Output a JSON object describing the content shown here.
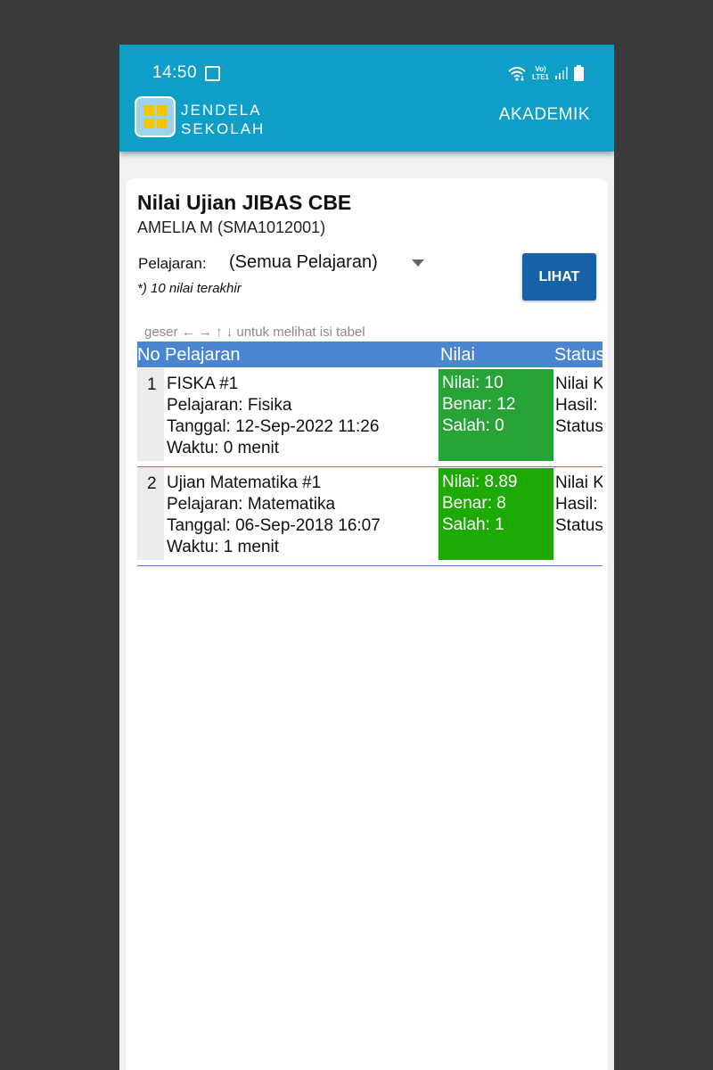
{
  "colors": {
    "appbar": "#0e9ec6",
    "table_header": "#4a85d0",
    "button": "#1662a5",
    "nilai_row1": "#28a338",
    "nilai_row2": "#1daa05",
    "logo_tile": "#f5c400"
  },
  "status_bar": {
    "time": "14:50",
    "image_icon": "image-icon",
    "network_label_top": "Vo)",
    "network_label_bottom": "LTE1",
    "wifi_icon": "wifi-icon",
    "signal_icon": "signal-icon",
    "battery_icon": "battery-icon"
  },
  "appbar": {
    "brand_line1": "JENDELA",
    "brand_line2": "SEKOLAH",
    "menu_label": "AKADEMIK"
  },
  "page": {
    "title": "Nilai Ujian JIBAS CBE",
    "student": "AMELIA M (SMA1012001)",
    "filter_label": "Pelajaran:",
    "filter_value": "(Semua Pelajaran)",
    "note": "*) 10 nilai terakhir",
    "button_label": "LIHAT",
    "hint": "geser ← → ↑ ↓ untuk melihat isi tabel"
  },
  "table": {
    "headers": [
      "No",
      "Pelajaran",
      "Nilai",
      "Status"
    ],
    "rows": [
      {
        "no": "1",
        "name": "FISKA #1",
        "subject": "Pelajaran: Fisika",
        "date": "Tanggal: 12-Sep-2022 11:26",
        "time": "Waktu: 0 menit",
        "score": "Nilai: 10",
        "correct": "Benar: 12",
        "wrong": "Salah: 0",
        "status1": "Nilai K",
        "status2": "Hasil:",
        "status3": "Status"
      },
      {
        "no": "2",
        "name": "Ujian Matematika #1",
        "subject": "Pelajaran: Matematika",
        "date": "Tanggal: 06-Sep-2018 16:07",
        "time": "Waktu: 1 menit",
        "score": "Nilai: 8.89",
        "correct": "Benar: 8",
        "wrong": "Salah: 1",
        "status1": "Nilai K",
        "status2": "Hasil:",
        "status3": "Status"
      }
    ]
  }
}
